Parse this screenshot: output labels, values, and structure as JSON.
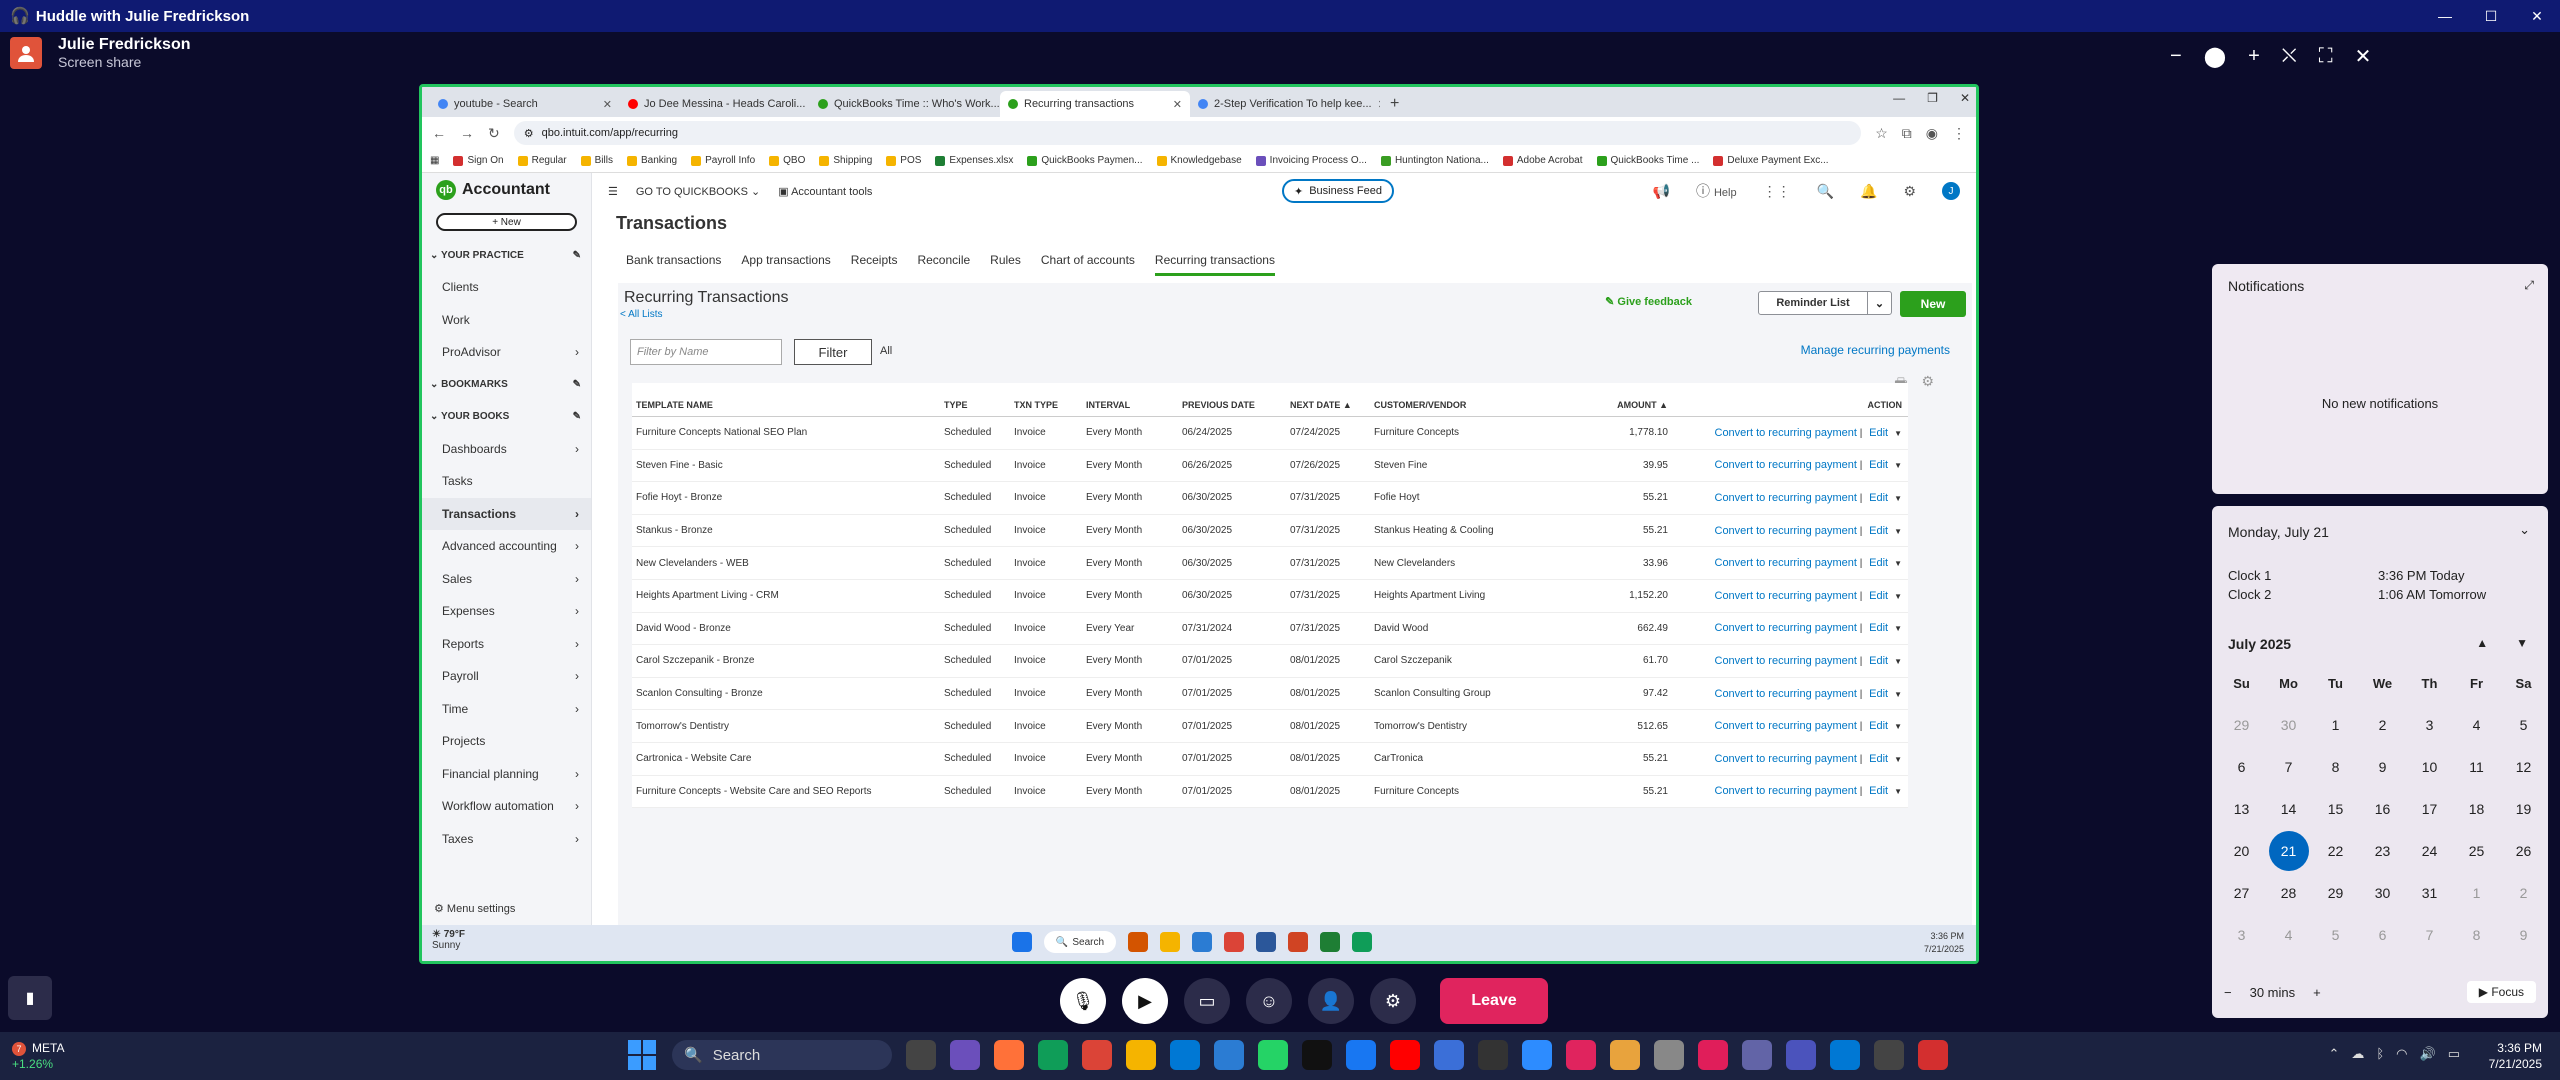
{
  "huddle": {
    "title": "Huddle with Julie Fredrickson",
    "presenter_name": "Julie Fredrickson",
    "presenter_sub": "Screen share",
    "controls": {
      "leave_label": "Leave"
    }
  },
  "browser": {
    "tabs": [
      {
        "label": "youtube - Search",
        "color": "#4285f4"
      },
      {
        "label": "Jo Dee Messina - Heads Caroli...",
        "color": "#ff0000"
      },
      {
        "label": "QuickBooks Time :: Who's Work...",
        "color": "#2ca01c"
      },
      {
        "label": "Recurring transactions",
        "color": "#2ca01c"
      },
      {
        "label": "2-Step Verification To help kee...",
        "color": "#4285f4"
      }
    ],
    "url": "qbo.intuit.com/app/recurring",
    "bookmarks": [
      {
        "label": "Sign On",
        "color": "#d32f2f"
      },
      {
        "label": "Regular",
        "color": "#f5b400"
      },
      {
        "label": "Bills",
        "color": "#f5b400"
      },
      {
        "label": "Banking",
        "color": "#f5b400"
      },
      {
        "label": "Payroll Info",
        "color": "#f5b400"
      },
      {
        "label": "QBO",
        "color": "#f5b400"
      },
      {
        "label": "Shipping",
        "color": "#f5b400"
      },
      {
        "label": "POS",
        "color": "#f5b400"
      },
      {
        "label": "Expenses.xlsx",
        "color": "#1e7e34"
      },
      {
        "label": "QuickBooks Paymen...",
        "color": "#2ca01c"
      },
      {
        "label": "Knowledgebase",
        "color": "#f5b400"
      },
      {
        "label": "Invoicing Process O...",
        "color": "#6b4fbb"
      },
      {
        "label": "Huntington Nationa...",
        "color": "#3a9d23"
      },
      {
        "label": "Adobe Acrobat",
        "color": "#d32f2f"
      },
      {
        "label": "QuickBooks Time ...",
        "color": "#2ca01c"
      },
      {
        "label": "Deluxe Payment Exc...",
        "color": "#d32f2f"
      }
    ]
  },
  "qbo": {
    "app_name": "Accountant",
    "new_label": "+ New",
    "goto_label": "GO TO QUICKBOOKS",
    "accountant_tools": "Accountant tools",
    "business_feed": "Business Feed",
    "help": "Help",
    "nav": [
      {
        "type": "section",
        "label": "YOUR PRACTICE"
      },
      {
        "type": "item",
        "label": "Clients"
      },
      {
        "type": "item",
        "label": "Work"
      },
      {
        "type": "item",
        "label": "ProAdvisor",
        "arrow": true
      },
      {
        "type": "section",
        "label": "BOOKMARKS"
      },
      {
        "type": "section",
        "label": "YOUR BOOKS"
      },
      {
        "type": "item",
        "label": "Dashboards",
        "arrow": true
      },
      {
        "type": "item",
        "label": "Tasks"
      },
      {
        "type": "item",
        "label": "Transactions",
        "arrow": true,
        "active": true
      },
      {
        "type": "item",
        "label": "Advanced accounting",
        "arrow": true
      },
      {
        "type": "item",
        "label": "Sales",
        "arrow": true
      },
      {
        "type": "item",
        "label": "Expenses",
        "arrow": true
      },
      {
        "type": "item",
        "label": "Reports",
        "arrow": true
      },
      {
        "type": "item",
        "label": "Payroll",
        "arrow": true
      },
      {
        "type": "item",
        "label": "Time",
        "arrow": true
      },
      {
        "type": "item",
        "label": "Projects"
      },
      {
        "type": "item",
        "label": "Financial planning",
        "arrow": true
      },
      {
        "type": "item",
        "label": "Workflow automation",
        "arrow": true
      },
      {
        "type": "item",
        "label": "Taxes",
        "arrow": true
      }
    ],
    "menu_settings": "Menu settings",
    "page_title": "Transactions",
    "subnav": [
      "Bank transactions",
      "App transactions",
      "Receipts",
      "Reconcile",
      "Rules",
      "Chart of accounts",
      "Recurring transactions"
    ],
    "recurring": {
      "title": "Recurring Transactions",
      "all_lists": "< All Lists",
      "give_feedback": "Give feedback",
      "reminder_list": "Reminder List",
      "new_label": "New",
      "filter_placeholder": "Filter by Name",
      "filter_label": "Filter",
      "all_label": "All",
      "manage_link": "Manage recurring payments",
      "columns": [
        "TEMPLATE NAME",
        "TYPE",
        "TXN TYPE",
        "INTERVAL",
        "PREVIOUS DATE",
        "NEXT DATE ▲",
        "CUSTOMER/VENDOR",
        "AMOUNT ▲",
        "ACTION"
      ],
      "convert_label": "Convert to recurring payment",
      "edit_label": "Edit",
      "rows": [
        [
          "Furniture Concepts National SEO Plan",
          "Scheduled",
          "Invoice",
          "Every Month",
          "06/24/2025",
          "07/24/2025",
          "Furniture Concepts",
          "1,778.10"
        ],
        [
          "Steven Fine - Basic",
          "Scheduled",
          "Invoice",
          "Every Month",
          "06/26/2025",
          "07/26/2025",
          "Steven Fine",
          "39.95"
        ],
        [
          "Fofie Hoyt - Bronze",
          "Scheduled",
          "Invoice",
          "Every Month",
          "06/30/2025",
          "07/31/2025",
          "Fofie Hoyt",
          "55.21"
        ],
        [
          "Stankus - Bronze",
          "Scheduled",
          "Invoice",
          "Every Month",
          "06/30/2025",
          "07/31/2025",
          "Stankus Heating & Cooling",
          "55.21"
        ],
        [
          "New Clevelanders - WEB",
          "Scheduled",
          "Invoice",
          "Every Month",
          "06/30/2025",
          "07/31/2025",
          "New Clevelanders",
          "33.96"
        ],
        [
          "Heights Apartment Living - CRM",
          "Scheduled",
          "Invoice",
          "Every Month",
          "06/30/2025",
          "07/31/2025",
          "Heights Apartment Living",
          "1,152.20"
        ],
        [
          "David Wood - Bronze",
          "Scheduled",
          "Invoice",
          "Every Year",
          "07/31/2024",
          "07/31/2025",
          "David Wood",
          "662.49"
        ],
        [
          "Carol Szczepanik - Bronze",
          "Scheduled",
          "Invoice",
          "Every Month",
          "07/01/2025",
          "08/01/2025",
          "Carol Szczepanik",
          "61.70"
        ],
        [
          "Scanlon Consulting - Bronze",
          "Scheduled",
          "Invoice",
          "Every Month",
          "07/01/2025",
          "08/01/2025",
          "Scanlon Consulting Group",
          "97.42"
        ],
        [
          "Tomorrow's Dentistry",
          "Scheduled",
          "Invoice",
          "Every Month",
          "07/01/2025",
          "08/01/2025",
          "Tomorrow's Dentistry",
          "512.65"
        ],
        [
          "Cartronica - Website Care",
          "Scheduled",
          "Invoice",
          "Every Month",
          "07/01/2025",
          "08/01/2025",
          "CarTronica",
          "55.21"
        ],
        [
          "Furniture Concepts - Website Care and SEO Reports",
          "Scheduled",
          "Invoice",
          "Every Month",
          "07/01/2025",
          "08/01/2025",
          "Furniture Concepts",
          "55.21"
        ]
      ]
    }
  },
  "remote_taskbar": {
    "temp": "79°F",
    "weather": "Sunny",
    "search": "Search",
    "time": "3:36 PM",
    "date": "7/21/2025"
  },
  "flyout": {
    "notifications_title": "Notifications",
    "no_notifications": "No new notifications",
    "date_header": "Monday, July 21",
    "clock1_label": "Clock 1",
    "clock1_value": "3:36 PM Today",
    "clock2_label": "Clock 2",
    "clock2_value": "1:06 AM Tomorrow",
    "month": "July 2025",
    "weekdays": [
      "Su",
      "Mo",
      "Tu",
      "We",
      "Th",
      "Fr",
      "Sa"
    ],
    "weeks": [
      [
        [
          "29",
          true
        ],
        [
          "30",
          true
        ],
        [
          "1"
        ],
        [
          "2"
        ],
        [
          "3"
        ],
        [
          "4"
        ],
        [
          "5"
        ]
      ],
      [
        [
          "6"
        ],
        [
          "7"
        ],
        [
          "8"
        ],
        [
          "9"
        ],
        [
          "10"
        ],
        [
          "11"
        ],
        [
          "12"
        ]
      ],
      [
        [
          "13"
        ],
        [
          "14"
        ],
        [
          "15"
        ],
        [
          "16"
        ],
        [
          "17"
        ],
        [
          "18"
        ],
        [
          "19"
        ]
      ],
      [
        [
          "20"
        ],
        [
          "21",
          false,
          true
        ],
        [
          "22"
        ],
        [
          "23"
        ],
        [
          "24"
        ],
        [
          "25"
        ],
        [
          "26"
        ]
      ],
      [
        [
          "27"
        ],
        [
          "28"
        ],
        [
          "29"
        ],
        [
          "30"
        ],
        [
          "31"
        ],
        [
          "1",
          true
        ],
        [
          "2",
          true
        ]
      ],
      [
        [
          "3",
          true
        ],
        [
          "4",
          true
        ],
        [
          "5",
          true
        ],
        [
          "6",
          true
        ],
        [
          "7",
          true
        ],
        [
          "8",
          true
        ],
        [
          "9",
          true
        ]
      ]
    ],
    "focus_minutes": "30 mins",
    "focus_label": "Focus"
  },
  "taskbar": {
    "stock_name": "META",
    "stock_change": "+1.26%",
    "stock_badge": "7",
    "search": "Search",
    "time": "3:36 PM",
    "date": "7/21/2025"
  }
}
